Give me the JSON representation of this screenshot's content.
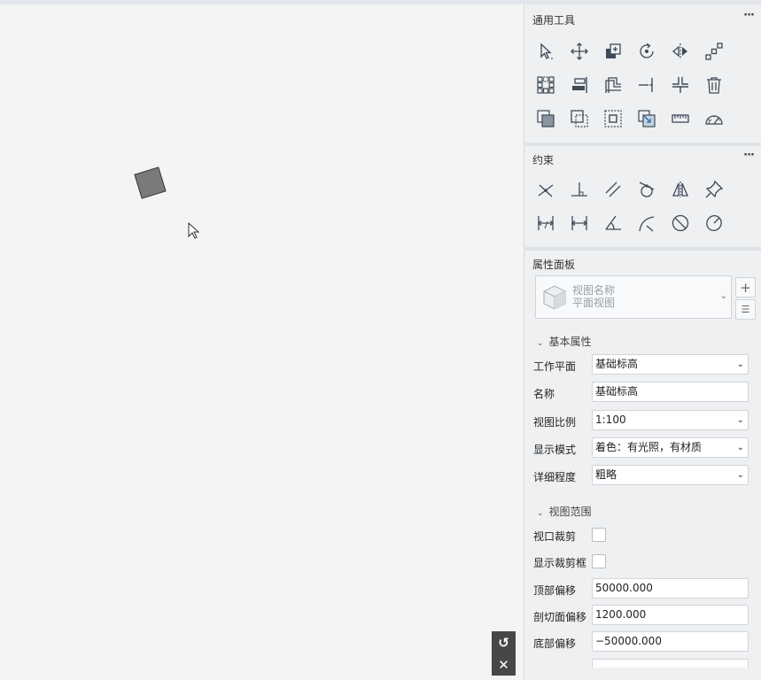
{
  "tools": {
    "title": "通用工具",
    "more": "···",
    "items": [
      {
        "name": "select-tool-icon"
      },
      {
        "name": "move-tool-icon"
      },
      {
        "name": "copy-tool-icon"
      },
      {
        "name": "rotate-tool-icon"
      },
      {
        "name": "mirror-tool-icon"
      },
      {
        "name": "array-tool-icon"
      },
      {
        "name": "grid-array-tool-icon"
      },
      {
        "name": "align-tool-icon"
      },
      {
        "name": "offset-tool-icon"
      },
      {
        "name": "trim-extend-tool-icon"
      },
      {
        "name": "split-tool-icon"
      },
      {
        "name": "delete-tool-icon"
      },
      {
        "name": "group-tool-icon"
      },
      {
        "name": "ungroup-tool-icon"
      },
      {
        "name": "pin-tool-icon"
      },
      {
        "name": "scale-tool-icon"
      },
      {
        "name": "measure-tool-icon"
      },
      {
        "name": "angle-measure-tool-icon"
      }
    ]
  },
  "constraints": {
    "title": "约束",
    "more": "···",
    "items": [
      {
        "name": "coincident-constraint-icon"
      },
      {
        "name": "perpendicular-constraint-icon"
      },
      {
        "name": "parallel-constraint-icon"
      },
      {
        "name": "tangent-constraint-icon"
      },
      {
        "name": "symmetric-constraint-icon"
      },
      {
        "name": "fixed-constraint-icon"
      },
      {
        "name": "linear-dimension-icon"
      },
      {
        "name": "aligned-dimension-icon"
      },
      {
        "name": "angle-dimension-icon"
      },
      {
        "name": "arc-dimension-icon"
      },
      {
        "name": "diameter-dimension-icon"
      },
      {
        "name": "radius-dimension-icon"
      }
    ]
  },
  "properties": {
    "title": "属性面板",
    "view_name_label": "视图名称",
    "view_name_value": "平面视图",
    "add_symbol": "+",
    "settings_symbol": "☰",
    "basic_group": "基本属性",
    "work_plane_label": "工作平面",
    "work_plane_value": "基础标高",
    "name_label": "名称",
    "name_value": "基础标高",
    "scale_label": "视图比例",
    "scale_value": "1:100",
    "display_label": "显示模式",
    "display_value": "着色：有光照，有材质",
    "detail_label": "详细程度",
    "detail_value": "粗略",
    "range_group": "视图范围",
    "crop_label": "视口裁剪",
    "crop_box_label": "显示裁剪框",
    "top_offset_label": "顶部偏移",
    "top_offset_value": "50000.000",
    "cut_offset_label": "剖切面偏移",
    "cut_offset_value": "1200.000",
    "bottom_offset_label": "底部偏移",
    "bottom_offset_value": "−50000.000"
  },
  "mini": {
    "undo_symbol": "↺",
    "close_symbol": "✕"
  },
  "colors": {
    "panel_bg": "#eef0f2",
    "icon_stroke": "#3e4a57",
    "shape_fill": "#7a7a7a"
  }
}
